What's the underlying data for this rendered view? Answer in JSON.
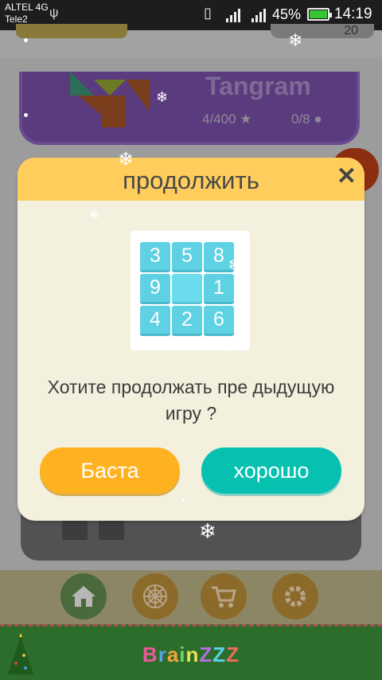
{
  "status_bar": {
    "carrier_1": "ALTEL 4G",
    "carrier_2": "Tele2",
    "battery_percent": "45%",
    "time": "14:19"
  },
  "background": {
    "tangram_stats": {
      "puzzles": "4/400",
      "awards": "0/8"
    },
    "coins_right": "20"
  },
  "dialog": {
    "title": "продолжить",
    "close_glyph": "✕",
    "question": "Хотите продолжать пре дыдущую игру ?",
    "puzzle_tiles": [
      "3",
      "5",
      "8",
      "9",
      "",
      "1",
      "4",
      "2",
      "6"
    ],
    "cancel_label": "Баста",
    "ok_label": "хорошо"
  },
  "nav": {
    "items": [
      {
        "icon": "home-icon"
      },
      {
        "icon": "spiderweb-icon"
      },
      {
        "icon": "cart-icon"
      },
      {
        "icon": "gear-icon"
      }
    ]
  },
  "brand": {
    "name": "BrainZZZ",
    "letter_colors": [
      "#e95a9a",
      "#5aa0e9",
      "#f2a63b",
      "#6fd36f",
      "#e9e45a",
      "#b36fe0",
      "#5ad0e9",
      "#e96d5a"
    ]
  },
  "colors": {
    "dialog_header": "#fecd5c",
    "dialog_body": "#f3f0de",
    "cancel_button": "#ffb220",
    "ok_button": "#07c1b0",
    "tile": "#5ed1e2"
  }
}
